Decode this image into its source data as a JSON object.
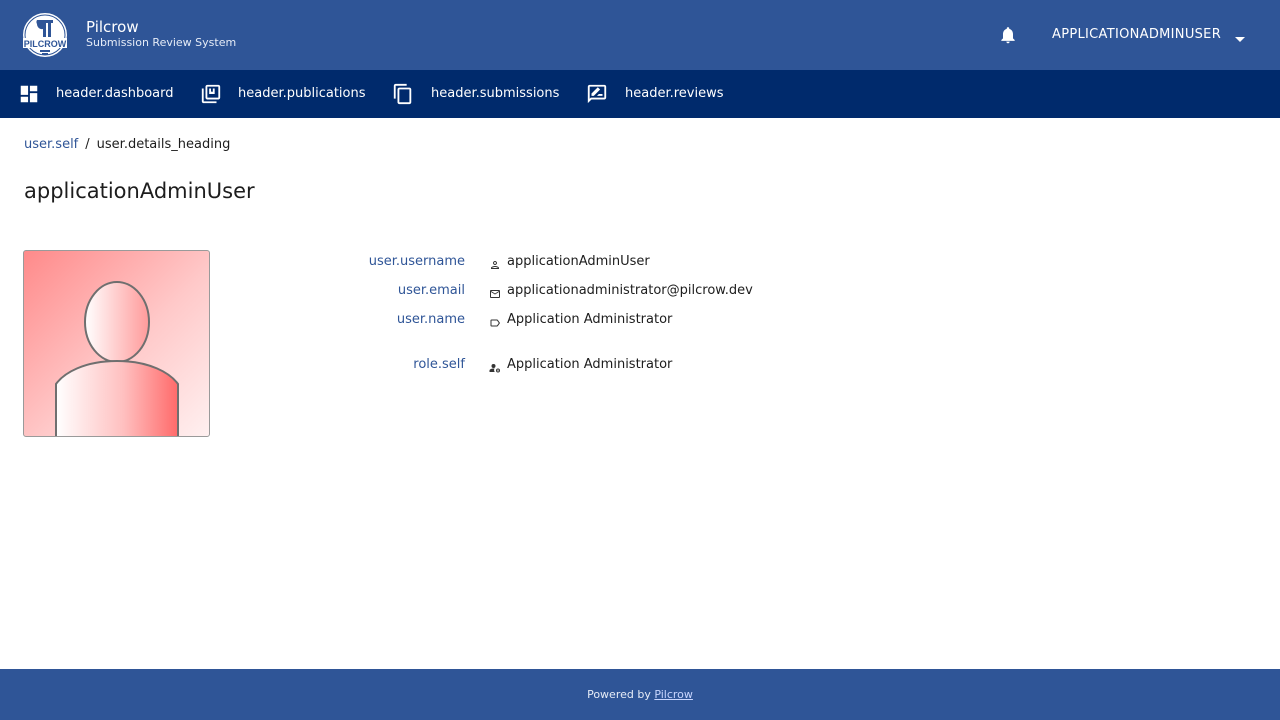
{
  "app": {
    "name": "Pilcrow",
    "subtitle": "Submission Review System",
    "logo_text": "PILCROW"
  },
  "header": {
    "notifications_icon": "bell-icon",
    "user_menu_label": "APPLICATIONADMINUSER",
    "user_menu_icon": "caret-down-icon"
  },
  "nav": {
    "items": [
      {
        "label": "header.dashboard",
        "icon": "dashboard-icon"
      },
      {
        "label": "header.publications",
        "icon": "library-books-icon"
      },
      {
        "label": "header.submissions",
        "icon": "copy-icon"
      },
      {
        "label": "header.reviews",
        "icon": "rate-review-icon"
      }
    ]
  },
  "breadcrumb": {
    "parent": "user.self",
    "separator": "/",
    "current": "user.details_heading"
  },
  "page": {
    "title": "applicationAdminUser"
  },
  "details": {
    "username_label": "user.username",
    "username_value": "applicationAdminUser",
    "username_icon": "person-icon",
    "email_label": "user.email",
    "email_value": "applicationadministrator@pilcrow.dev",
    "email_icon": "mail-icon",
    "name_label": "user.name",
    "name_value": "Application Administrator",
    "name_icon": "label-icon",
    "role_label": "role.self",
    "role_value": "Application Administrator",
    "role_icon": "manage-accounts-icon"
  },
  "footer": {
    "prefix": "Powered by",
    "link": "Pilcrow"
  },
  "colors": {
    "header_bg": "#2f5597",
    "nav_bg": "#002a6c",
    "link": "#2f5597",
    "avatar_gradient_start": "#ff8a8a"
  }
}
